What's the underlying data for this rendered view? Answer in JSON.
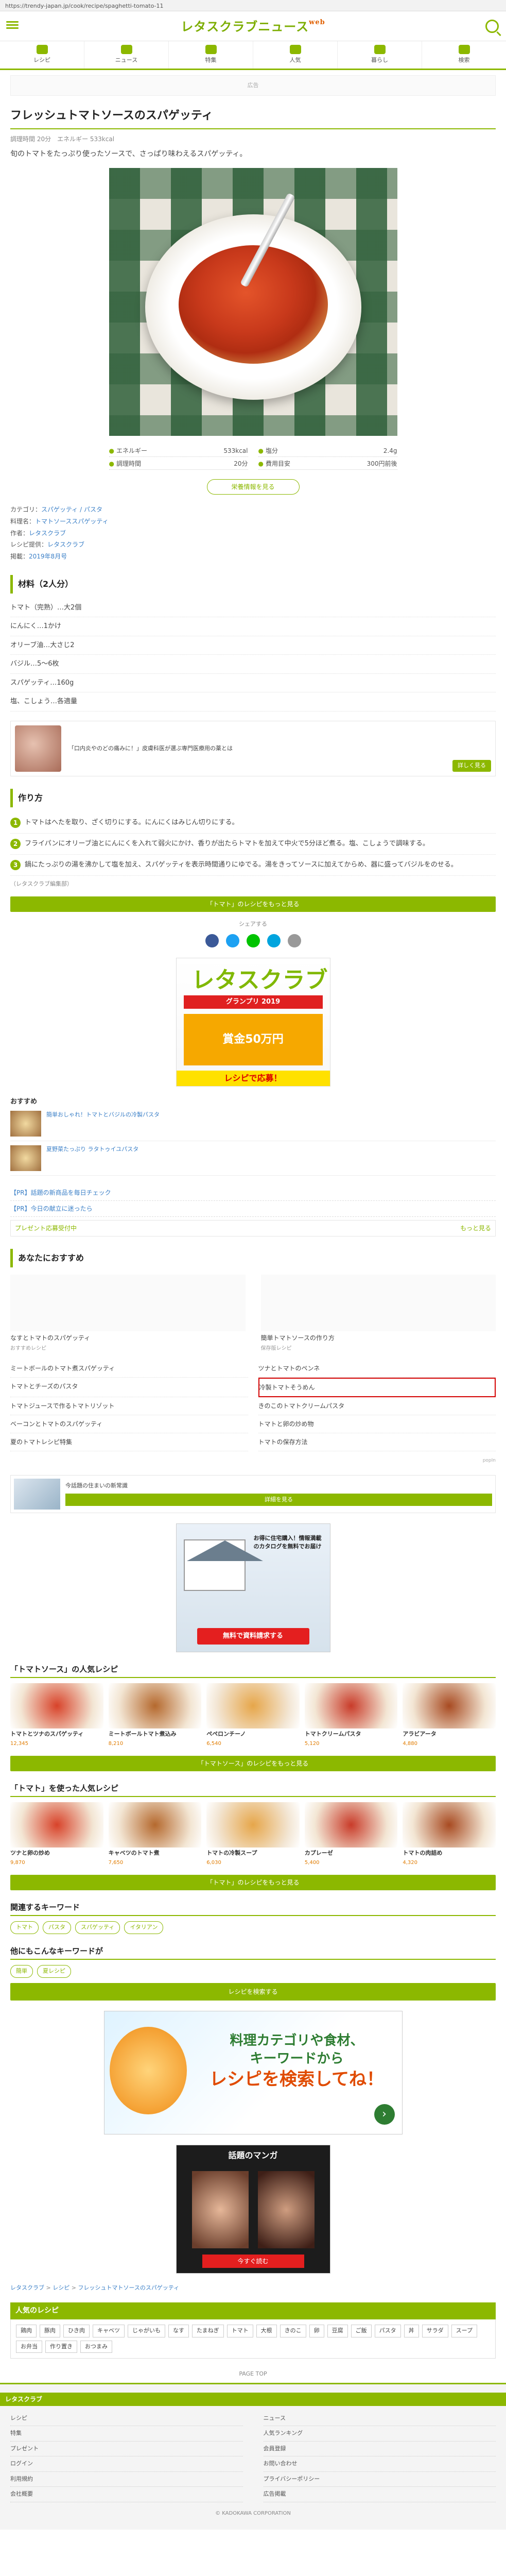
{
  "url": "https://trendy-japan.jp/cook/recipe/spaghetti-tomato-11",
  "header": {
    "logo": "レタスクラブニュース",
    "logo_small": "web"
  },
  "gnav": [
    {
      "label": "レシピ"
    },
    {
      "label": "ニュース"
    },
    {
      "label": "特集"
    },
    {
      "label": "人気"
    },
    {
      "label": "暮らし"
    },
    {
      "label": "検索"
    }
  ],
  "ad_label": "広告",
  "article": {
    "title": "フレッシュトマトソースのスパゲッティ",
    "meta": "調理時間 20分　エネルギー 533kcal",
    "intro": "旬のトマトをたっぷり使ったソースで、さっぱり味わえるスパゲッティ。"
  },
  "nutrition": [
    {
      "label": "エネルギー",
      "value": "533kcal"
    },
    {
      "label": "塩分",
      "value": "2.4g"
    },
    {
      "label": "調理時間",
      "value": "20分"
    },
    {
      "label": "費用目安",
      "value": "300円前後"
    }
  ],
  "nutrition_button": "栄養情報を見る",
  "info": [
    {
      "label": "カテゴリ：",
      "value": "スパゲッティ / パスタ"
    },
    {
      "label": "料理名：",
      "value": "トマトソーススパゲッティ"
    },
    {
      "label": "作者：",
      "value": "レタスクラブ"
    },
    {
      "label": "レシピ提供：",
      "value": "レタスクラブ"
    },
    {
      "label": "掲載：",
      "value": "2019年8月号"
    }
  ],
  "ingredients_heading": "材料（2人分）",
  "ingredients": [
    "トマト（完熟）…大2個",
    "にんにく…1かけ",
    "オリーブ油…大さじ2",
    "バジル…5～6枚",
    "スパゲッティ…160g",
    "塩、こしょう…各適量"
  ],
  "tie_up": {
    "text": "「口内炎やのどの痛みに！」皮膚科医が選ぶ専門医療用の薬とは",
    "button": "詳しく見る"
  },
  "steps_heading": "作り方",
  "steps": [
    "トマトはへたを取り、ざく切りにする。にんにくはみじん切りにする。",
    "フライパンにオリーブ油とにんにくを入れて弱火にかけ、香りが出たらトマトを加えて中火で5分ほど煮る。塩、こしょうで調味する。",
    "鍋にたっぷりの湯を沸かして塩を加え、スパゲッティを表示時間通りにゆでる。湯をきってソースに加えてからめ、器に盛ってバジルをのせる。"
  ],
  "steps_note": "（レタスクラブ編集部）",
  "more_button": "「トマト」のレシピをもっと見る",
  "share_label": "シェアする",
  "grandprix": {
    "logo": "レタスクラブ",
    "sub": "グランプリ 2019",
    "orange": "賞金50万円",
    "bottom": "レシピで応募！"
  },
  "osusume_heading": "おすすめ",
  "osusume": [
    "簡単おしゃれ！トマトとバジルの冷製パスタ",
    "夏野菜たっぷり ラタトゥイユパスタ"
  ],
  "pr_lines": [
    "【PR】話題の新商品を毎日チェック",
    "【PR】今日の献立に迷ったら"
  ],
  "pr_box": {
    "text": "プレゼント応募受付中",
    "more": "もっと見る"
  },
  "recs_heading": "あなたにおすすめ",
  "recs": [
    {
      "title": "なすとトマトのスパゲッティ",
      "sub": "おすすめレシピ"
    },
    {
      "title": "簡単トマトソースの作り方",
      "sub": "保存版レシピ"
    }
  ],
  "links": [
    "ミートボールのトマト煮スパゲッティ",
    "ツナとトマトのペンネ",
    "トマトとチーズのパスタ",
    "冷製トマトそうめん",
    "トマトジュースで作るトマトリゾット",
    "きのこのトマトクリームパスタ",
    "ベーコンとトマトのスパゲッティ",
    "トマトと卵の炒め物",
    "夏のトマトレシピ特集",
    "トマトの保存方法"
  ],
  "highlight_index": 3,
  "popin": "popIn",
  "ad_stripe": {
    "text": "今話題の住まいの新常識",
    "btn": "詳細を見る"
  },
  "house": {
    "text": "お得に住宅購入！情報満載のカタログを無料でお届け",
    "btn": "無料で資料請求する"
  },
  "related1": {
    "title": "「トマトソース」の人気レシピ",
    "items": [
      {
        "title": "トマトとツナのスパゲッティ",
        "likes": "12,345"
      },
      {
        "title": "ミートボールトマト煮込み",
        "likes": "8,210"
      },
      {
        "title": "ペペロンチーノ",
        "likes": "6,540"
      },
      {
        "title": "トマトクリームパスタ",
        "likes": "5,120"
      },
      {
        "title": "アラビアータ",
        "likes": "4,880"
      }
    ],
    "more": "「トマトソース」のレシピをもっと見る"
  },
  "related2": {
    "title": "「トマト」を使った人気レシピ",
    "items": [
      {
        "title": "ツナと卵の炒め",
        "likes": "9,870"
      },
      {
        "title": "キャベツのトマト煮",
        "likes": "7,650"
      },
      {
        "title": "トマトの冷製スープ",
        "likes": "6,030"
      },
      {
        "title": "カプレーゼ",
        "likes": "5,400"
      },
      {
        "title": "トマトの肉詰め",
        "likes": "4,320"
      }
    ],
    "more": "「トマト」のレシピをもっと見る"
  },
  "tags_heading": "関連するキーワード",
  "tags": [
    "トマト",
    "パスタ",
    "スパゲッティ",
    "イタリアン"
  ],
  "tags2_heading": "他にもこんなキーワードが",
  "tags2": [
    "簡単",
    "夏レシピ"
  ],
  "green_button": "レシピを検索する",
  "search_banner": {
    "line1": "料理カテゴリや食材、",
    "line2": "キーワードから",
    "big": "レシピを検索してね！"
  },
  "manga": {
    "title": "話題のマンガ",
    "btn": "今すぐ読む"
  },
  "breadcrumb": [
    "レタスクラブ",
    "レシピ",
    "フレッシュトマトソースのスパゲッティ"
  ],
  "popular_title": "人気のレシピ",
  "popular_tags": [
    "鶏肉",
    "豚肉",
    "ひき肉",
    "キャベツ",
    "じゃがいも",
    "なす",
    "たまねぎ",
    "トマト",
    "大根",
    "きのこ",
    "卵",
    "豆腐",
    "ご飯",
    "パスタ",
    "丼",
    "サラダ",
    "スープ",
    "お弁当",
    "作り置き",
    "おつまみ"
  ],
  "pagetop": "PAGE TOP",
  "footer": {
    "title": "レタスクラブ",
    "links": [
      "レシピ",
      "ニュース",
      "特集",
      "人気ランキング",
      "プレゼント",
      "会員登録",
      "ログイン",
      "お問い合わせ",
      "利用規約",
      "プライバシーポリシー",
      "会社概要",
      "広告掲載"
    ]
  },
  "copyright": "© KADOKAWA CORPORATION"
}
